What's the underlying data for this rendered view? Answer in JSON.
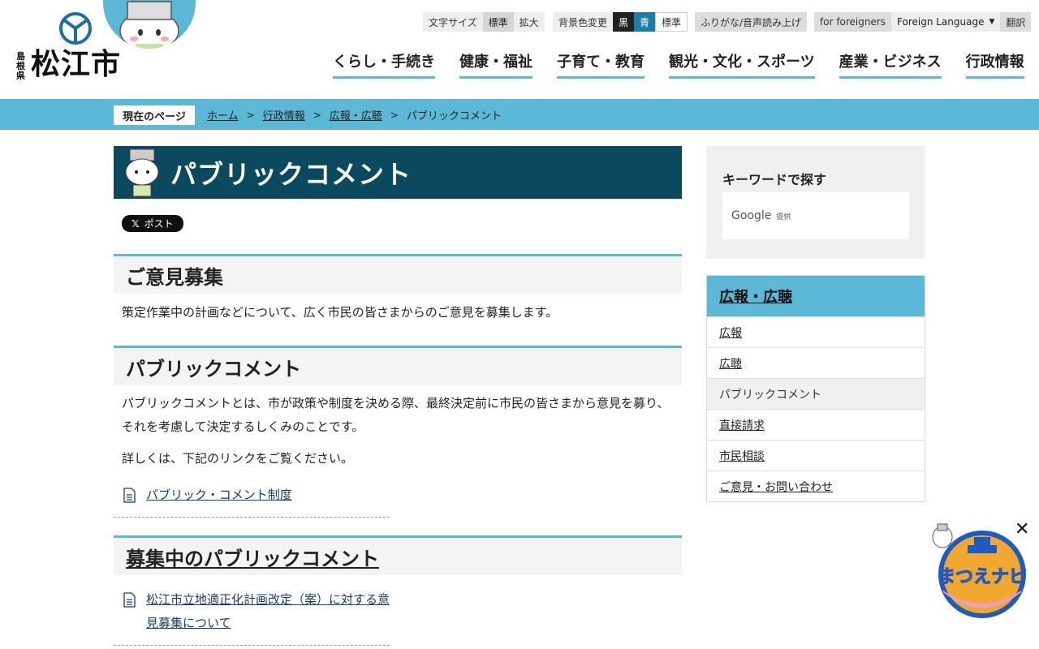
{
  "logo": {
    "prefecture": "島根県",
    "city": "松江市"
  },
  "utility": {
    "font_size_label": "文字サイズ",
    "font_standard": "標準",
    "font_large": "拡大",
    "bg_label": "背景色変更",
    "bg_black": "黒",
    "bg_blue": "青",
    "bg_standard": "標準",
    "furigana": "ふりがな/音声読み上げ",
    "foreigners": "for foreigners",
    "foreign_language": "Foreign Language",
    "translate": "翻訳"
  },
  "gnav": [
    "くらし・手続き",
    "健康・福祉",
    "子育て・教育",
    "観光・文化・スポーツ",
    "産業・ビジネス",
    "行政情報"
  ],
  "breadcrumb": {
    "label": "現在のページ",
    "items": [
      "ホーム",
      "行政情報",
      "広報・広聴"
    ],
    "current": "パブリックコメント"
  },
  "page": {
    "title": "パブリックコメント",
    "x_post": "ポスト",
    "sections": [
      {
        "heading": "ご意見募集",
        "text": "策定作業中の計画などについて、広く市民の皆さまからのご意見を募集します。"
      },
      {
        "heading": "パブリックコメント",
        "text1": "パブリックコメントとは、市が政策や制度を決める際、最終決定前に市民の皆さまから意見を募り、それを考慮して決定するしくみのことです。",
        "text2": "詳しくは、下記のリンクをご覧ください。",
        "link": "パブリック・コメント制度"
      },
      {
        "heading": "募集中のパブリックコメント",
        "link": "松江市立地適正化計画改定（案）に対する意見募集について"
      }
    ]
  },
  "sidebar": {
    "keyword_title": "キーワードで探す",
    "google": "Google",
    "google_provided": "提供",
    "nav_title": "広報・広聴",
    "items": [
      "広報",
      "広聴",
      "パブリックコメント",
      "直接請求",
      "市民相談",
      "ご意見・お問い合わせ"
    ]
  },
  "navi": {
    "label": "まつえナビ",
    "close": "✕"
  },
  "colors": {
    "accent": "#5bb8d6",
    "title_bg": "#0b4a5e"
  }
}
